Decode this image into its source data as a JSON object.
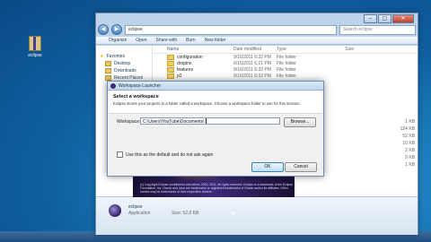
{
  "desktop": {
    "icon_label": "eclipse"
  },
  "explorer": {
    "address": "eclipse",
    "search_placeholder": "Search eclipse",
    "toolbar": [
      "Organize",
      "Open",
      "Share with",
      "Burn",
      "New folder"
    ],
    "nav_items": [
      "Favorites",
      "Desktop",
      "Downloads",
      "Recent Places"
    ],
    "columns": {
      "name": "Name",
      "date": "Date modified",
      "type": "Type",
      "size": "Size"
    },
    "rows": [
      {
        "name": "configuration",
        "date": "9/16/2011 6:32 PM",
        "type": "File folder",
        "size": ""
      },
      {
        "name": "dropins",
        "date": "6/15/2011 6:21 PM",
        "type": "File folder",
        "size": ""
      },
      {
        "name": "features",
        "date": "9/16/2011 6:32 PM",
        "type": "File folder",
        "size": ""
      },
      {
        "name": "p2",
        "date": "9/16/2011 6:32 PM",
        "type": "File folder",
        "size": ""
      }
    ],
    "right_sizes": [
      "1 KB",
      "124 KB",
      "52 KB",
      "10 KB",
      "2 KB",
      "9 KB",
      "1 KB"
    ],
    "details": {
      "name": "eclipse",
      "kind": "Application",
      "size": "Size: 52.0 KB"
    }
  },
  "splash": {
    "copyright": "(c) Copyright Eclipse contributors and others 2000, 2011. All rights reserved. Eclipse is a trademark of the Eclipse Foundation, Inc. Oracle and Java are trademarks or registered trademarks of Oracle and/or its affiliates. Other names may be trademarks of their respective owners."
  },
  "dialog": {
    "title": "Workspace Launcher",
    "heading": "Select a workspace",
    "description": "Eclipse stores your projects in a folder called a workspace. Choose a workspace folder to use for this session.",
    "workspace_label": "Workspace:",
    "workspace_value": "C:\\Users\\YouTube\\Documents\\",
    "browse_label": "Browse...",
    "checkbox_label": "Use this as the default and do not ask again",
    "ok_label": "OK",
    "cancel_label": "Cancel"
  }
}
